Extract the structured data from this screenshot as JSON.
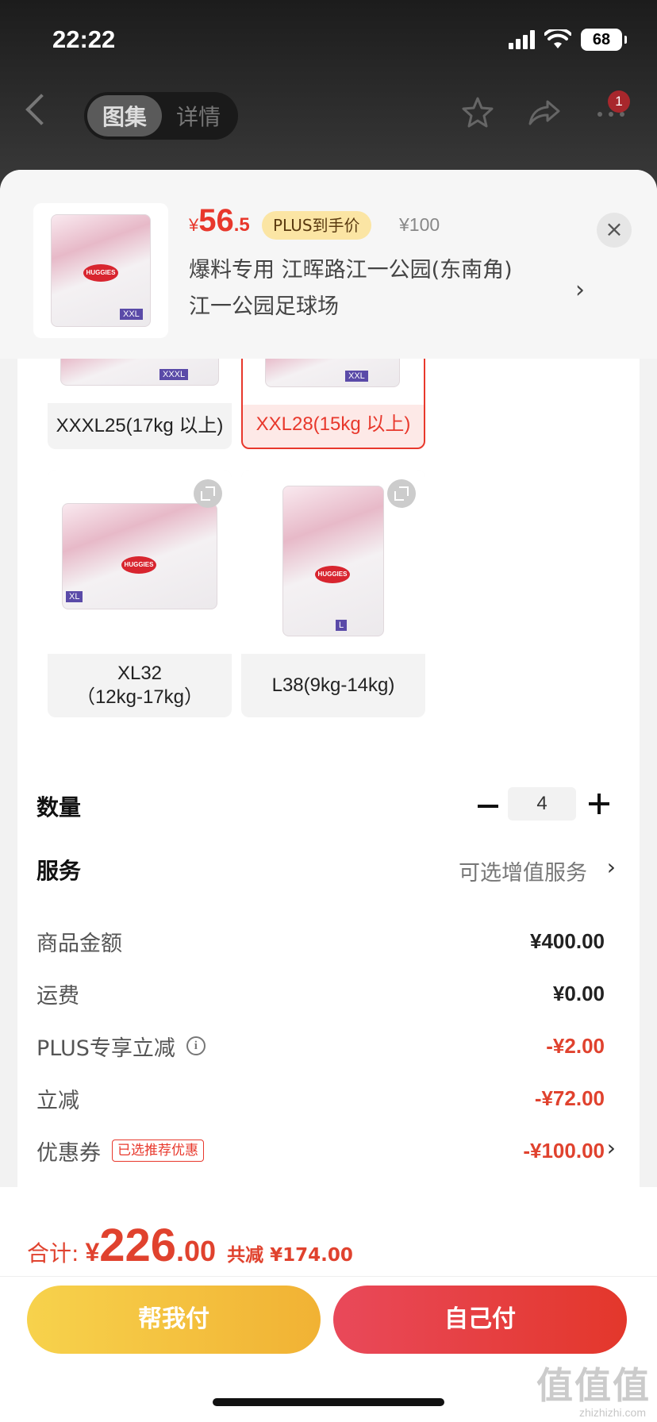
{
  "status": {
    "time": "22:22",
    "battery": "68"
  },
  "nav": {
    "tab_gallery": "图集",
    "tab_detail": "详情",
    "badge_count": "1"
  },
  "product": {
    "price_currency": "¥",
    "price_int": "56",
    "price_dec": ".5",
    "plus_tag": "PLUS到手价",
    "original_price": "¥100",
    "address_line1": "爆料专用  江晖路江一公园(东南角)",
    "address_line2": "江一公园足球场",
    "close": "×"
  },
  "specs": [
    {
      "label": "XXXL25(17kg 以上)",
      "size_tag": "XXXL",
      "selected": false
    },
    {
      "label": "XXL28(15kg 以上)",
      "size_tag": "XXL",
      "selected": true
    },
    {
      "label_line1": "XL32",
      "label_line2": "（12kg-17kg）",
      "size_tag": "XL",
      "selected": false
    },
    {
      "label": "L38(9kg-14kg)",
      "size_tag": "L",
      "selected": false
    }
  ],
  "pack_brand": "HUGGIES",
  "quantity": {
    "label": "数量",
    "value": "4"
  },
  "service": {
    "label": "服务",
    "value": "可选增值服务"
  },
  "price_breakdown": {
    "goods_label": "商品金额",
    "goods_value": "¥400.00",
    "shipping_label": "运费",
    "shipping_value": "¥0.00",
    "plus_label": "PLUS专享立减",
    "plus_value": "-¥2.00",
    "instant_label": "立减",
    "instant_value": "-¥72.00",
    "coupon_label": "优惠券",
    "coupon_tag": "已选推荐优惠",
    "coupon_value": "-¥100.00"
  },
  "total": {
    "label": "合计:",
    "currency": "¥",
    "int": "226",
    "dec": ".00",
    "saved": "共减 ¥174.00"
  },
  "buttons": {
    "help_pay": "帮我付",
    "self_pay": "自己付"
  },
  "watermark": {
    "main": "值值值",
    "sub": "zhizhizhi.com"
  },
  "colors": {
    "accent_red": "#e8382c",
    "help_yellow": "#f3c23f"
  }
}
